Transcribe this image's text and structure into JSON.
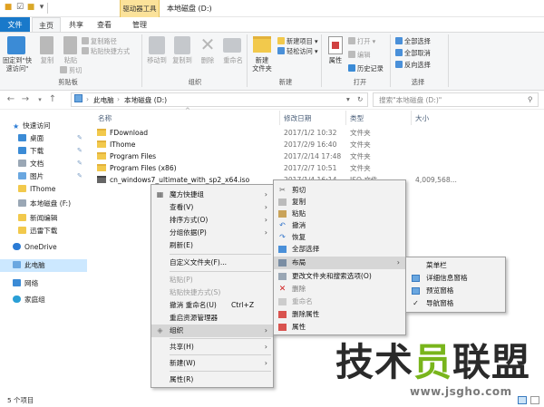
{
  "window": {
    "title": "本地磁盘 (D:)",
    "context_tab": "驱动器工具"
  },
  "tabs": {
    "file": "文件",
    "home": "主页",
    "share": "共享",
    "view": "查看",
    "manage": "管理"
  },
  "ribbon": {
    "pin": "固定到\"快\n速访问\"",
    "copy": "复制",
    "paste": "粘贴",
    "copy_path": "复制路径",
    "paste_shortcut": "粘贴快捷方式",
    "cut": "剪切",
    "clipboard": "剪贴板",
    "move_to": "移动到",
    "copy_to": "复制到",
    "delete": "删除",
    "rename": "重命名",
    "organize": "组织",
    "new_folder": "新建\n文件夹",
    "new_item": "新建项目",
    "easy_access": "轻松访问",
    "new": "新建",
    "properties": "属性",
    "open": "打开",
    "edit": "编辑",
    "history": "历史记录",
    "open_group": "打开",
    "select_all": "全部选择",
    "select_none": "全部取消",
    "invert": "反向选择",
    "select": "选择"
  },
  "address": {
    "crumbs": [
      "此电脑",
      "本地磁盘 (D:)"
    ],
    "search_placeholder": "搜索\"本地磁盘 (D:)\""
  },
  "columns": {
    "name": "名称",
    "date": "修改日期",
    "type": "类型",
    "size": "大小"
  },
  "files": [
    {
      "name": "FDownload",
      "date": "2017/1/2 10:32",
      "type": "文件夹",
      "size": ""
    },
    {
      "name": "IThome",
      "date": "2017/2/9 16:40",
      "type": "文件夹",
      "size": ""
    },
    {
      "name": "Program Files",
      "date": "2017/2/14 17:48",
      "type": "文件夹",
      "size": ""
    },
    {
      "name": "Program Files (x86)",
      "date": "2017/2/7 10:51",
      "type": "文件夹",
      "size": ""
    },
    {
      "name": "cn_windows7_ultimate_with_sp2_x64.iso",
      "date": "2017/1/4 16:14",
      "type": "ISO 文件",
      "size": "4,009,568..."
    }
  ],
  "sidebar": [
    "快速访问",
    "桌面",
    "下载",
    "文档",
    "图片",
    "IThome",
    "本地磁盘 (F:)",
    "新闻编辑",
    "迅雷下载",
    "OneDrive",
    "此电脑",
    "网络",
    "家庭组"
  ],
  "menu1": [
    "魔方快捷组",
    "查看(V)",
    "排序方式(O)",
    "分组依据(P)",
    "刷新(E)",
    "自定义文件夹(F)...",
    "粘贴(P)",
    "粘贴快捷方式(S)",
    "撤消 重命名(U)",
    "Ctrl+Z",
    "重启资源管理器",
    "组织",
    "共享(H)",
    "新建(W)",
    "属性(R)"
  ],
  "menu2": [
    "剪切",
    "复制",
    "粘贴",
    "撤消",
    "恢复",
    "全部选择",
    "布局",
    "更改文件夹和搜索选项(O)",
    "删除",
    "重命名",
    "删除属性",
    "属性"
  ],
  "menu3": [
    "菜单栏",
    "详细信息窗格",
    "预览窗格",
    "导航窗格"
  ],
  "status": "5 个项目",
  "watermark": {
    "text": "技术员联盟",
    "url": "www.jsgho.com"
  }
}
